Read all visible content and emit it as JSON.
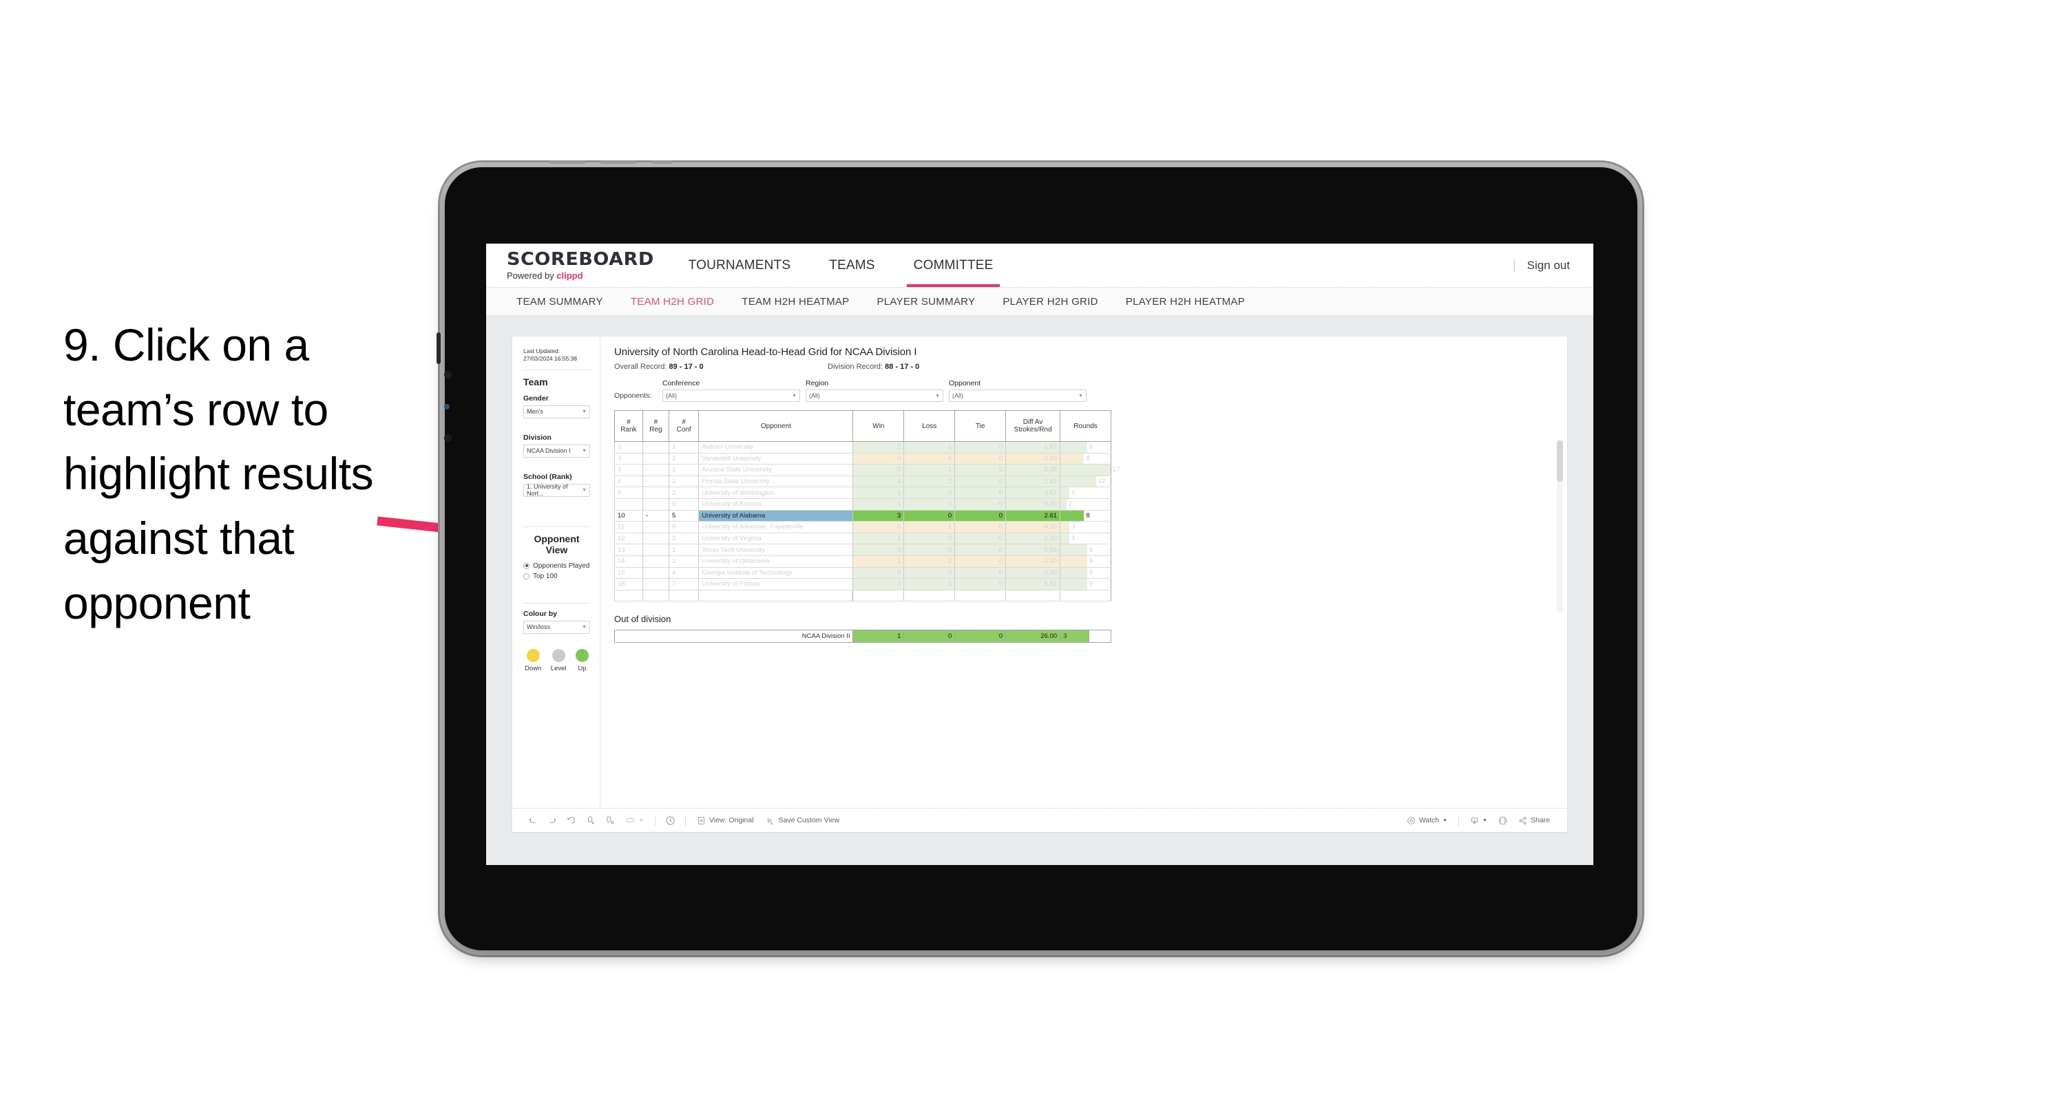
{
  "annotation": {
    "text": "9. Click on a team’s row to highlight results against that opponent",
    "arrow_color": "#ED2E63"
  },
  "topnav": {
    "logo_main": "SCOREBOARD",
    "logo_sub_prefix": "Powered by ",
    "logo_sub_brand": "clippd",
    "items": [
      {
        "label": "TOURNAMENTS",
        "active": false
      },
      {
        "label": "TEAMS",
        "active": false
      },
      {
        "label": "COMMITTEE",
        "active": true
      }
    ],
    "divider": "|",
    "signout": "Sign out"
  },
  "subnav": {
    "items": [
      {
        "label": "TEAM SUMMARY",
        "active": false
      },
      {
        "label": "TEAM H2H GRID",
        "active": true
      },
      {
        "label": "TEAM H2H HEATMAP",
        "active": false
      },
      {
        "label": "PLAYER SUMMARY",
        "active": false
      },
      {
        "label": "PLAYER H2H GRID",
        "active": false
      },
      {
        "label": "PLAYER H2H HEATMAP",
        "active": false
      }
    ]
  },
  "sidebar": {
    "last_updated": "Last Updated: 27/03/2024 16:55:38",
    "team_heading": "Team",
    "gender_label": "Gender",
    "gender_value": "Men's",
    "division_label": "Division",
    "division_value": "NCAA Division I",
    "school_label": "School (Rank)",
    "school_value": "1. University of Nort...",
    "opponent_view_heading": "Opponent View",
    "opponent_view_options": [
      {
        "label": "Opponents Played",
        "selected": true
      },
      {
        "label": "Top 100",
        "selected": false
      }
    ],
    "colour_by_label": "Colour by",
    "colour_by_value": "Win/loss",
    "legend": [
      {
        "label": "Down",
        "color": "#F5D440"
      },
      {
        "label": "Level",
        "color": "#C8CBCD"
      },
      {
        "label": "Up",
        "color": "#7DC855"
      }
    ]
  },
  "main": {
    "title": "University of North Carolina Head-to-Head Grid for NCAA Division I",
    "overall_record_label": "Overall Record: ",
    "overall_record_value": "89 - 17 - 0",
    "division_record_label": "Division Record: ",
    "division_record_value": "88 - 17 - 0",
    "opponents_label": "Opponents:",
    "filters": [
      {
        "label": "Conference",
        "value": "(All)"
      },
      {
        "label": "Region",
        "value": "(All)"
      },
      {
        "label": "Opponent",
        "value": "(All)"
      }
    ]
  },
  "chart_data": {
    "type": "table",
    "title": "University of North Carolina Head-to-Head Grid for NCAA Division I",
    "columns": [
      "# Rank",
      "# Reg",
      "# Conf",
      "Opponent",
      "Win",
      "Loss",
      "Tie",
      "Diff Av Strokes/Rnd",
      "Rounds"
    ],
    "rounds_max": 17,
    "rows": [
      {
        "rank": "2",
        "reg": "-",
        "conf": "1",
        "opponent": "Auburn University",
        "win": "2",
        "loss": "1",
        "tie": "0",
        "diff": "1.67",
        "rounds": "9",
        "tone": "up",
        "highlighted": false
      },
      {
        "rank": "3",
        "reg": "-",
        "conf": "2",
        "opponent": "Vanderbilt University",
        "win": "0",
        "loss": "4",
        "tie": "0",
        "diff": "-2.29",
        "rounds": "8",
        "tone": "down",
        "highlighted": false
      },
      {
        "rank": "4",
        "reg": "-",
        "conf": "1",
        "opponent": "Arizona State University",
        "win": "5",
        "loss": "1",
        "tie": "0",
        "diff": "2.28",
        "rounds": "17",
        "tone": "up",
        "highlighted": false
      },
      {
        "rank": "6",
        "reg": "-",
        "conf": "2",
        "opponent": "Florida State University",
        "win": "4",
        "loss": "2",
        "tie": "0",
        "diff": "1.83",
        "rounds": "12",
        "tone": "up",
        "highlighted": false
      },
      {
        "rank": "8",
        "reg": "-",
        "conf": "2",
        "opponent": "University of Washington",
        "win": "1",
        "loss": "0",
        "tie": "0",
        "diff": "3.67",
        "rounds": "3",
        "tone": "up",
        "highlighted": false
      },
      {
        "rank": "",
        "reg": "-",
        "conf": "3",
        "opponent": "University of Arizona",
        "win": "1",
        "loss": "0",
        "tie": "0",
        "diff": "9.00",
        "rounds": "2",
        "tone": "up",
        "highlighted": false
      },
      {
        "rank": "10",
        "reg": "-",
        "conf": "5",
        "opponent": "University of Alabama",
        "win": "3",
        "loss": "0",
        "tie": "0",
        "diff": "2.61",
        "rounds": "8",
        "tone": "up",
        "highlighted": true
      },
      {
        "rank": "11",
        "reg": "-",
        "conf": "6",
        "opponent": "University of Arkansas, Fayetteville",
        "win": "0",
        "loss": "1",
        "tie": "0",
        "diff": "-4.33",
        "rounds": "3",
        "tone": "down",
        "highlighted": false
      },
      {
        "rank": "12",
        "reg": "-",
        "conf": "3",
        "opponent": "University of Virginia",
        "win": "1",
        "loss": "0",
        "tie": "0",
        "diff": "2.33",
        "rounds": "3",
        "tone": "up",
        "highlighted": false
      },
      {
        "rank": "13",
        "reg": "-",
        "conf": "1",
        "opponent": "Texas Tech University",
        "win": "3",
        "loss": "0",
        "tie": "0",
        "diff": "5.56",
        "rounds": "9",
        "tone": "up",
        "highlighted": false
      },
      {
        "rank": "14",
        "reg": "-",
        "conf": "2",
        "opponent": "University of Oklahoma",
        "win": "1",
        "loss": "2",
        "tie": "0",
        "diff": "-1.00",
        "rounds": "9",
        "tone": "down",
        "highlighted": false
      },
      {
        "rank": "15",
        "reg": "-",
        "conf": "4",
        "opponent": "Georgia Institute of Technology",
        "win": "5",
        "loss": "0",
        "tie": "0",
        "diff": "4.50",
        "rounds": "9",
        "tone": "up",
        "highlighted": false
      },
      {
        "rank": "16",
        "reg": "-",
        "conf": "7",
        "opponent": "University of Florida",
        "win": "3",
        "loss": "1",
        "tie": "0",
        "diff": "6.62",
        "rounds": "9",
        "tone": "up",
        "highlighted": false
      }
    ],
    "out_of_division": {
      "title": "Out of division",
      "label": "NCAA Division II",
      "win": "1",
      "loss": "0",
      "tie": "0",
      "diff": "26.00",
      "rounds": "3"
    }
  },
  "toolbar": {
    "items": [
      {
        "name": "undo-icon",
        "label": ""
      },
      {
        "name": "redo-icon",
        "label": ""
      },
      {
        "name": "revert-icon",
        "label": ""
      },
      {
        "name": "refresh-data-icon",
        "label": ""
      },
      {
        "name": "pause-updates-icon",
        "label": ""
      },
      {
        "name": "device-layout-icon",
        "label": ""
      },
      {
        "name": "clock-history-icon",
        "label": ""
      },
      {
        "name": "view-original-icon",
        "label": "View: Original"
      },
      {
        "name": "save-custom-view-icon",
        "label": "Save Custom View"
      },
      {
        "name": "watch-icon",
        "label": "Watch"
      },
      {
        "name": "download-icon",
        "label": ""
      },
      {
        "name": "fullscreen-icon",
        "label": ""
      },
      {
        "name": "share-icon",
        "label": "Share"
      }
    ]
  }
}
